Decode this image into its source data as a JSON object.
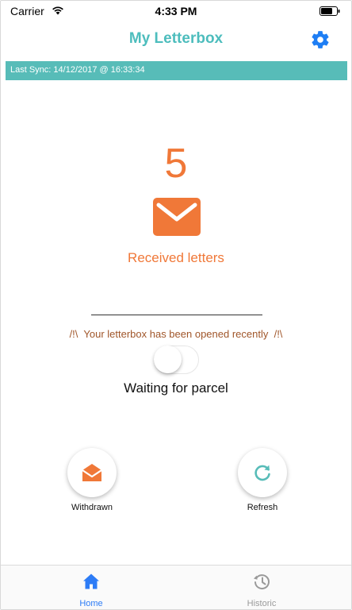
{
  "status_bar": {
    "carrier": "Carrier",
    "time": "4:33 PM",
    "icons": [
      "wifi-icon",
      "battery-icon"
    ]
  },
  "header": {
    "title": "My Letterbox",
    "settings_icon": "gear-icon"
  },
  "sync": {
    "text": "Last Sync: 14/12/2017 @ 16:33:34"
  },
  "letters": {
    "count": "5",
    "label": "Received letters",
    "icon": "envelope-icon"
  },
  "alert": {
    "text": "/!\\  Your letterbox has been opened recently  /!\\"
  },
  "parcel": {
    "toggle_on": false,
    "label": "Waiting for parcel"
  },
  "actions": {
    "withdrawn_label": "Withdrawn",
    "withdrawn_icon": "open-envelope-icon",
    "refresh_label": "Refresh",
    "refresh_icon": "refresh-icon"
  },
  "tabs": [
    {
      "label": "Home",
      "icon": "home-icon",
      "active": true
    },
    {
      "label": "Historic",
      "icon": "history-icon",
      "active": false
    }
  ],
  "colors": {
    "accent_teal": "#57bcb8",
    "title_teal": "#4dbdbd",
    "letters_orange": "#f07838",
    "alert_brown": "#a0562a",
    "tab_active_blue": "#2d7cf6",
    "gear_blue": "#1e7ef4"
  }
}
